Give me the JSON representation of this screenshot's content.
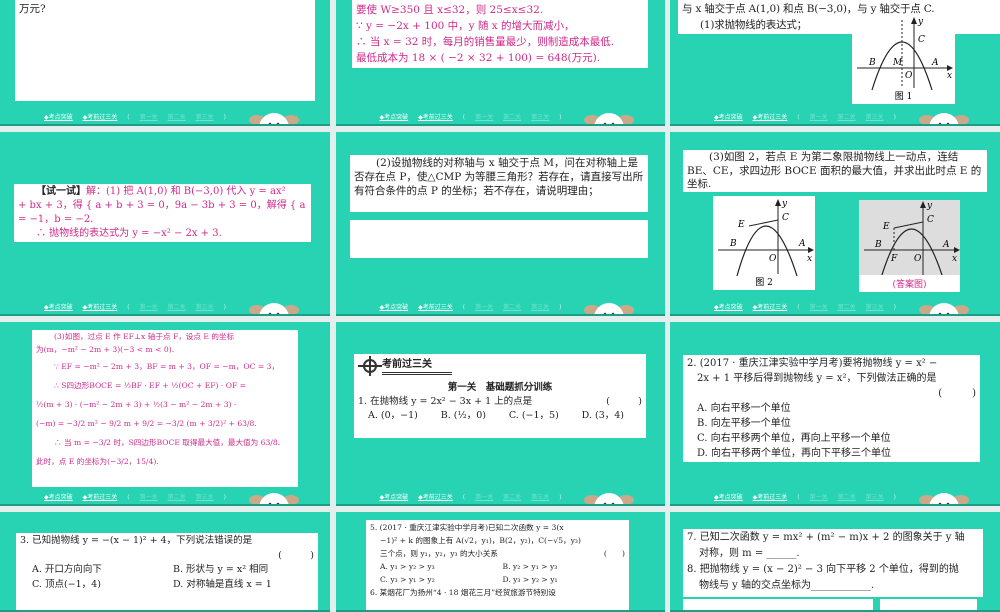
{
  "footer": {
    "nav1": "◆考点突破",
    "nav2": "◆考前过三关",
    "open": "(",
    "g1": "第一关",
    "g2": "第二关",
    "g3": "第三关",
    "close": ")"
  },
  "s1": {
    "line1": "万元?"
  },
  "s2": {
    "lines": [
      "要使 W≥350 且 x≤32，则 25≤x≤32.",
      "∵ y = −2x + 100 中，y 随 x 的增大而减小，",
      "∴ 当 x = 32 时，每月的销售量最少，则制造成本最低.",
      "最低成本为 18 × ( −2 × 32 + 100) = 648(万元)."
    ]
  },
  "s3": {
    "lines": [
      "与 x 轴交于点 A(1,0) 和点 B(−3,0)，与 y 轴交于点 C.",
      "(1)求抛物线的表达式；"
    ],
    "fig_label": "图 1",
    "labels": {
      "y": "y",
      "c": "C",
      "b": "B",
      "m": "M",
      "a": "A",
      "o": "O",
      "x": "x"
    }
  },
  "s4": {
    "tag": "【试一试】",
    "lines": [
      "解：(1) 把 A(1,0) 和 B(−3,0) 代入 y = ax²",
      "+ bx + 3，得 { a + b + 3 = 0，9a − 3b + 3 = 0，解得 { a = −1，b = −2.",
      "∴ 抛物线的表达式为 y = −x² − 2x + 3."
    ]
  },
  "s5": {
    "text": "(2)设抛物线的对称轴与 x 轴交于点 M，问在对称轴上是否存在点 P，使△CMP 为等腰三角形？若存在，请直接写出所有符合条件的点 P 的坐标；若不存在，请说明理由；"
  },
  "s6": {
    "text": "(3)如图 2，若点 E 为第二象限抛物线上一动点，连结 BE、CE，求四边形 BOCE 面积的最大值，并求出此时点 E 的坐标.",
    "fig2_label": "图 2",
    "ans_label": "(答案图)",
    "labels": {
      "y": "y",
      "c": "C",
      "e": "E",
      "b": "B",
      "a": "A",
      "o": "O",
      "x": "x",
      "f": "F"
    }
  },
  "s7": {
    "lines": [
      "(3)如图，过点 E 作 EF⊥x 轴于点 F，设点 E 的坐标",
      "为(m，−m² − 2m + 3)(−3 < m < 0).",
      "∵ EF = −m² − 2m + 3，BF = m + 3，OF = −m，OC = 3，",
      "∴ S四边形BOCE = ½BF · EF + ½(OC + EF) · OF =",
      "½(m + 3) · (−m² − 2m + 3) + ½(3 − m² − 2m + 3) ·",
      "(−m) = −3/2 m² − 9/2 m + 9/2 = −3/2 (m + 3/2)² + 63/8.",
      "∴ 当 m = −3/2 时，S四边形BOCE 取得最大值，最大值为 63/8.",
      "此时，点 E 的坐标为(−3/2，15/4)."
    ]
  },
  "s8": {
    "header": "考前过三关",
    "section": "第一关　基础题抓分训练",
    "q": "1. 在抛物线 y = 2x² − 3x + 1 上的点是",
    "paren": "(　　　)",
    "opts": [
      "A. (0，−1)",
      "B. (½，0)",
      "C. (−1，5)",
      "D. (3，4)"
    ]
  },
  "s9": {
    "q1": "2. (2017 · 重庆江津实验中学月考)要将抛物线 y = x² −",
    "q2": "2x + 1 平移后得到抛物线 y = x²，下列做法正确的是",
    "paren": "(　　　)",
    "opts": [
      "A. 向右平移一个单位",
      "B. 向左平移一个单位",
      "C. 向右平移两个单位，再向上平移一个单位",
      "D. 向右平移两个单位，再向下平移三个单位"
    ]
  },
  "s10": {
    "q": "3. 已知抛物线 y = −(x − 1)² + 4，下列说法错误的是",
    "paren": "(　　　)",
    "opts": [
      "A. 开口方向向下",
      "B. 形状与 y = x² 相同",
      "C. 顶点(−1，4)",
      "D. 对称轴是直线 x = 1"
    ]
  },
  "s11": {
    "lines": [
      "5. (2017 · 重庆江津实验中学月考)已知二次函数 y = 3(x",
      "−1)² + k 的图象上有 A(√2，y₁)，B(2，y₂)，C(−√5，y₃)",
      "三个点，则 y₁，y₂，y₃ 的大小关系"
    ],
    "paren": "(　　)",
    "opts": [
      "A. y₁ > y₂ > y₃",
      "B. y₂ > y₁ > y₃",
      "C. y₃ > y₁ > y₂",
      "D. y₃ > y₂ > y₁"
    ],
    "q6": "6. 某烟花厂为扬州“4 · 18 烟花三月”经贸旅游节特别设"
  },
  "s12": {
    "lines": [
      "7. 已知二次函数 y = mx² + (m² − m)x + 2 的图象关于 y 轴",
      "对称，则 m = ______.",
      "8. 把抛物线 y = (x − 2)² − 3 向下平移 2 个单位，得到的抛",
      "物线与 y 轴的交点坐标为____________."
    ]
  }
}
